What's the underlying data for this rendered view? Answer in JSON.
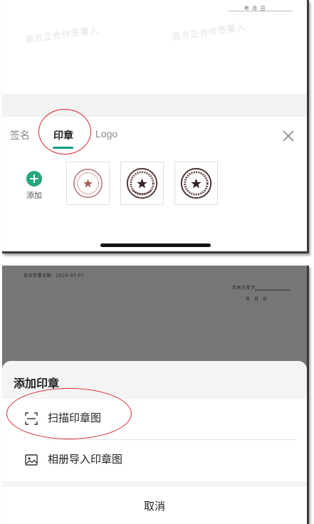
{
  "top_screen": {
    "document": {
      "date_text": "年    月    日",
      "watermark": "我方正合作签署人"
    },
    "tabs": [
      {
        "label": "签名",
        "active": false
      },
      {
        "label": "印章",
        "active": true
      },
      {
        "label": "Logo",
        "active": false
      }
    ],
    "add_label": "添加",
    "accent_color": "#16a085",
    "highlight_color": "#d9262c",
    "seal_count": 3
  },
  "bottom_screen": {
    "document": {
      "line1": "协议签署日期：2024-03-07",
      "line2": "合同方签字：",
      "line3": "年  月  日"
    },
    "sheet_title": "添加印章",
    "menu": [
      {
        "label": "扫描印章图",
        "icon": "scan-icon"
      },
      {
        "label": "相册导入印章图",
        "icon": "image-icon"
      }
    ],
    "cancel_label": "取消"
  }
}
